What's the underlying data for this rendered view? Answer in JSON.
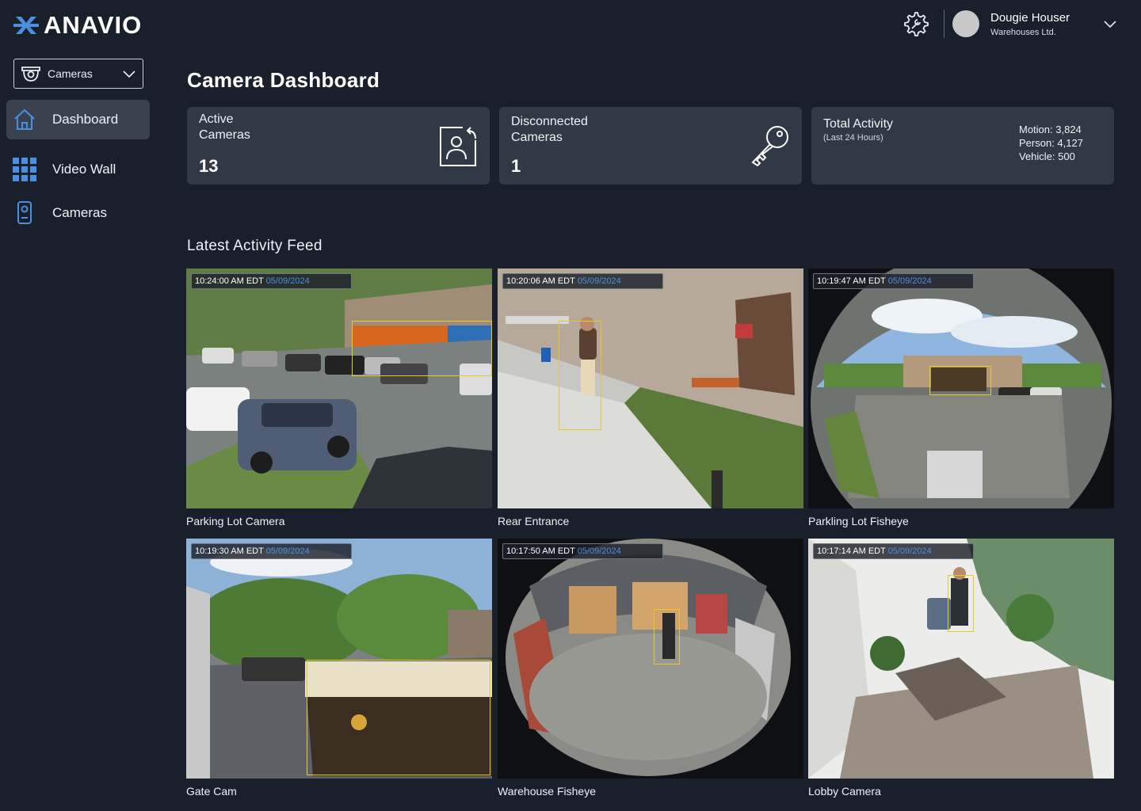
{
  "brand": {
    "name": "ANAVIO"
  },
  "header": {
    "settings_icon": "gear-wrench-icon",
    "user": {
      "name": "Dougie Houser",
      "org": "Warehouses Ltd."
    }
  },
  "sidebar": {
    "selector": {
      "label": "Cameras",
      "icon": "camera-dome-icon"
    },
    "items": [
      {
        "label": "Dashboard",
        "icon": "home-icon",
        "active": true
      },
      {
        "label": "Video Wall",
        "icon": "grid-icon",
        "active": false
      },
      {
        "label": "Cameras",
        "icon": "device-camera-icon",
        "active": false
      }
    ]
  },
  "main": {
    "title": "Camera Dashboard",
    "cards": {
      "active": {
        "title_line1": "Active",
        "title_line2": "Cameras",
        "value": "13"
      },
      "disconnected": {
        "title_line1": "Disconnected",
        "title_line2": "Cameras",
        "value": "1"
      },
      "activity": {
        "title": "Total Activity",
        "subtitle": "(Last 24 Hours)",
        "motion": "Motion: 3,824",
        "person": "Person: 4,127",
        "vehicle": "Vehicle: 500"
      }
    },
    "feed_title": "Latest Activity Feed",
    "feed": [
      {
        "time": "10:24:00 AM EDT",
        "date": "05/09/2024",
        "label": "Parking Lot Camera"
      },
      {
        "time": "10:20:06 AM EDT",
        "date": "05/09/2024",
        "label": "Rear Entrance"
      },
      {
        "time": "10:19:47 AM EDT",
        "date": "05/09/2024",
        "label": "Parkling Lot Fisheye"
      },
      {
        "time": "10:19:30 AM EDT",
        "date": "05/09/2024",
        "label": "Gate Cam"
      },
      {
        "time": "10:17:50 AM EDT",
        "date": "05/09/2024",
        "label": "Warehouse Fisheye"
      },
      {
        "time": "10:17:14 AM EDT",
        "date": "05/09/2024",
        "label": "Lobby Camera"
      }
    ]
  },
  "colors": {
    "background": "#19202b",
    "card": "#323946",
    "accent": "#4b8fe0",
    "detection_box": "#e7c92b"
  }
}
